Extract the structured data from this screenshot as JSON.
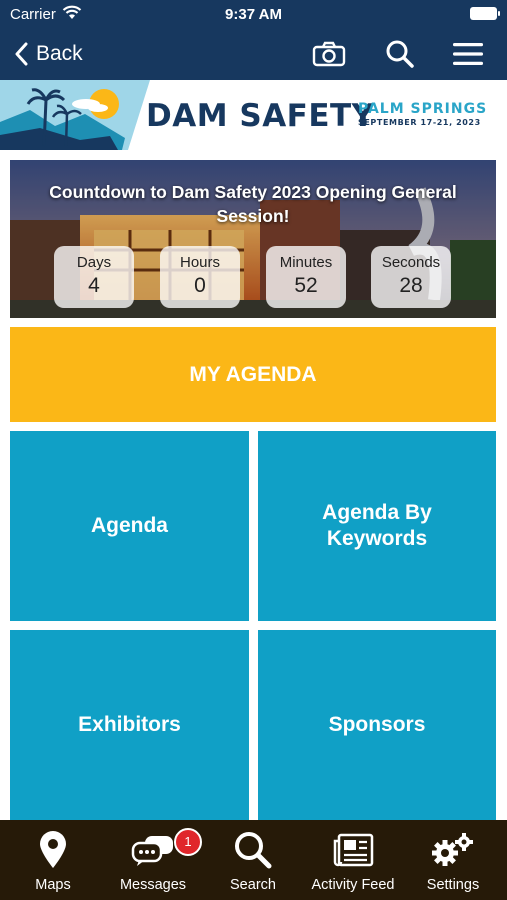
{
  "status_bar": {
    "carrier": "Carrier",
    "time": "9:37 AM"
  },
  "nav": {
    "back_label": "Back"
  },
  "banner": {
    "brand": "DAM SAFETY",
    "location": "PALM SPRINGS",
    "dates": "SEPTEMBER 17-21, 2023"
  },
  "countdown": {
    "title": "Countdown to Dam Safety 2023 Opening General Session!",
    "days_label": "Days",
    "days": "4",
    "hours_label": "Hours",
    "hours": "0",
    "minutes_label": "Minutes",
    "minutes": "52",
    "seconds_label": "Seconds",
    "seconds": "28"
  },
  "tiles": {
    "my_agenda": "MY AGENDA",
    "agenda": "Agenda",
    "agenda_by_keywords": "Agenda By Keywords",
    "exhibitors": "Exhibitors",
    "sponsors": "Sponsors"
  },
  "tabbar": {
    "maps": "Maps",
    "messages": "Messages",
    "messages_badge": "1",
    "search": "Search",
    "activity_feed": "Activity Feed",
    "settings": "Settings"
  },
  "colors": {
    "nav": "#17385f",
    "gold": "#fbb717",
    "teal": "#10a0c6",
    "tabbar": "#261a08",
    "badge": "#e0262b"
  }
}
